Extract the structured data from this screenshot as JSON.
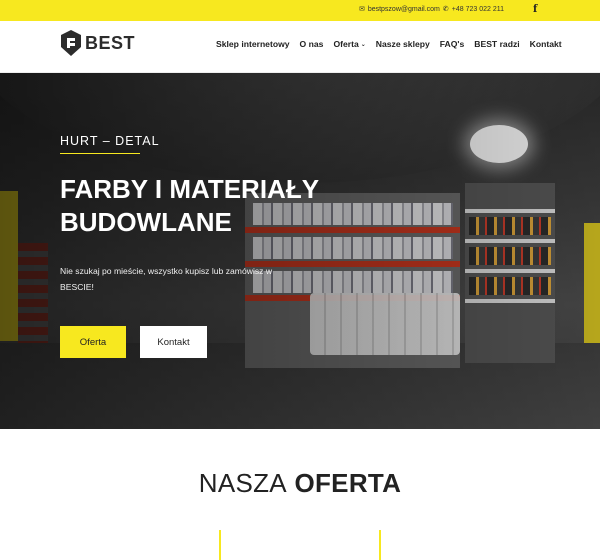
{
  "topbar": {
    "email": "bestpszow@gmail.com",
    "phone": "+48 723 022 211",
    "email_icon": "mail-icon",
    "phone_icon": "phone-icon",
    "social_icon": "facebook-icon",
    "facebook_glyph": "f",
    "bg_color": "#f7e81f"
  },
  "header": {
    "logo_text": "BEST",
    "logo_icon": "shield-logo-icon",
    "nav": [
      {
        "label": "Sklep internetowy"
      },
      {
        "label": "O nas"
      },
      {
        "label": "Oferta",
        "has_dropdown": true
      },
      {
        "label": "Nasze sklepy"
      },
      {
        "label": "FAQ's"
      },
      {
        "label": "BEST radzi"
      },
      {
        "label": "Kontakt"
      }
    ]
  },
  "hero": {
    "kicker": "HURT – DETAL",
    "title_line1": "FARBY I MATERIAŁY",
    "title_line2": "BUDOWLANE",
    "description": "Nie szukaj po mieście, wszystko kupisz lub zamówisz w BESCIE!",
    "primary_button": "Oferta",
    "secondary_button": "Kontakt",
    "accent_color": "#f7e81f"
  },
  "section": {
    "heading_light": "NASZA",
    "heading_bold": "OFERTA"
  }
}
